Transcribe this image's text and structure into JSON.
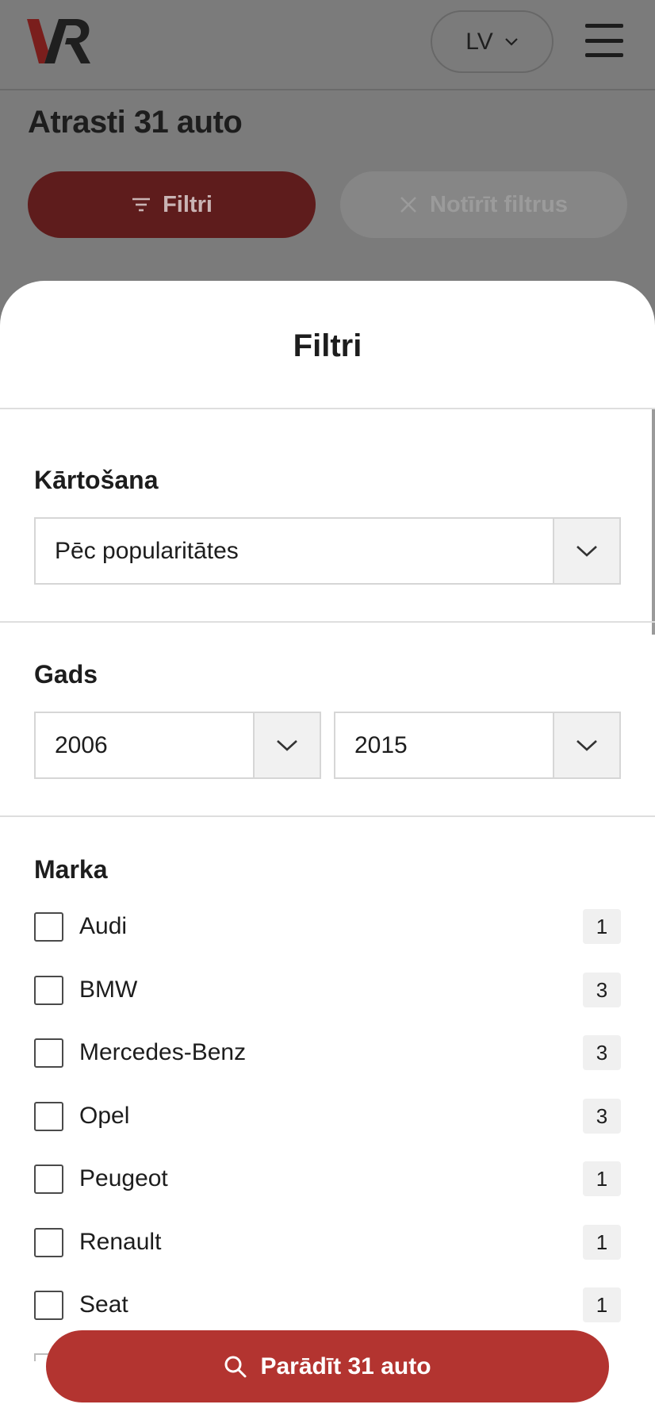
{
  "header": {
    "language_label": "LV"
  },
  "results": {
    "title": "Atrasti 31 auto",
    "filters_button_label": "Filtri",
    "clear_filters_label": "Notīrīt filtrus"
  },
  "sheet": {
    "title": "Filtri",
    "sorting": {
      "label": "Kārtošana",
      "selected": "Pēc popularitātes"
    },
    "year": {
      "label": "Gads",
      "from": "2006",
      "to": "2015"
    },
    "brand": {
      "label": "Marka",
      "items": [
        {
          "name": "Audi",
          "count": "1"
        },
        {
          "name": "BMW",
          "count": "3"
        },
        {
          "name": "Mercedes-Benz",
          "count": "3"
        },
        {
          "name": "Opel",
          "count": "3"
        },
        {
          "name": "Peugeot",
          "count": "1"
        },
        {
          "name": "Renault",
          "count": "1"
        },
        {
          "name": "Seat",
          "count": "1"
        }
      ]
    },
    "show_button_label": "Parādīt 31 auto"
  },
  "colors": {
    "brand_red": "#b33430",
    "overlay": "#7b7b7b"
  }
}
